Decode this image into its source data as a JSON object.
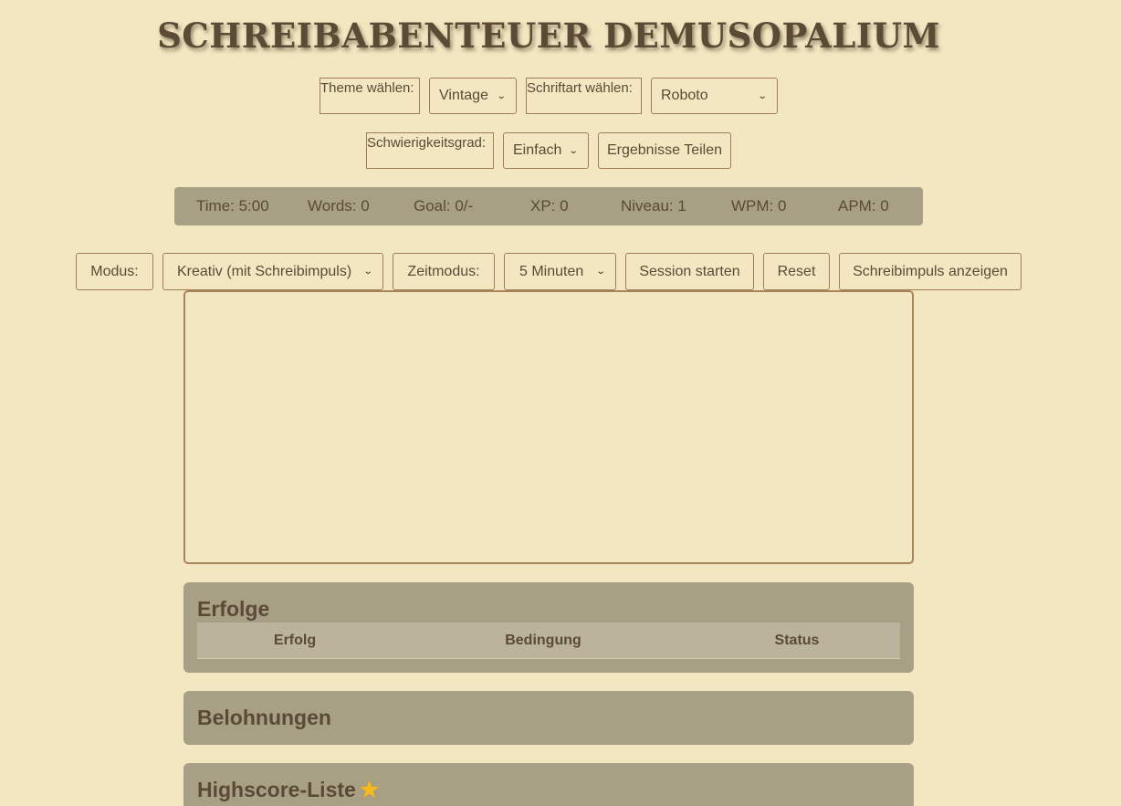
{
  "app": {
    "title": "SCHREIBABENTEUER DEMUSOPALIUM"
  },
  "settings": {
    "theme_label": "Theme wählen:",
    "theme_value": "Vintage",
    "font_label": "Schriftart wählen:",
    "font_value": "Roboto",
    "difficulty_label": "Schwierigkeitsgrad:",
    "difficulty_value": "Einfach",
    "share_label": "Ergebnisse Teilen"
  },
  "stats": {
    "time": "Time: 5:00",
    "words": "Words: 0",
    "goal": "Goal: 0/-",
    "xp": "XP: 0",
    "level": "Niveau: 1",
    "wpm": "WPM: 0",
    "apm": "APM: 0"
  },
  "controls": {
    "mode_label": "Modus:",
    "mode_value": "Kreativ (mit Schreibimpuls)",
    "time_mode_label": "Zeitmodus:",
    "time_mode_value": "5 Minuten",
    "start_label": "Session starten",
    "reset_label": "Reset",
    "prompt_label": "Schreibimpuls anzeigen"
  },
  "editor": {
    "value": ""
  },
  "achievements": {
    "title": "Erfolge",
    "columns": [
      "Erfolg",
      "Bedingung",
      "Status"
    ]
  },
  "rewards": {
    "title": "Belohnungen"
  },
  "highscores": {
    "title": "Highscore-Liste",
    "icon": "star-icon",
    "icon_color": "#f5b921"
  },
  "colors": {
    "background": "#f3e7c2",
    "panel": "#a8a084",
    "text": "#5b4a36",
    "border": "#a07d52"
  }
}
